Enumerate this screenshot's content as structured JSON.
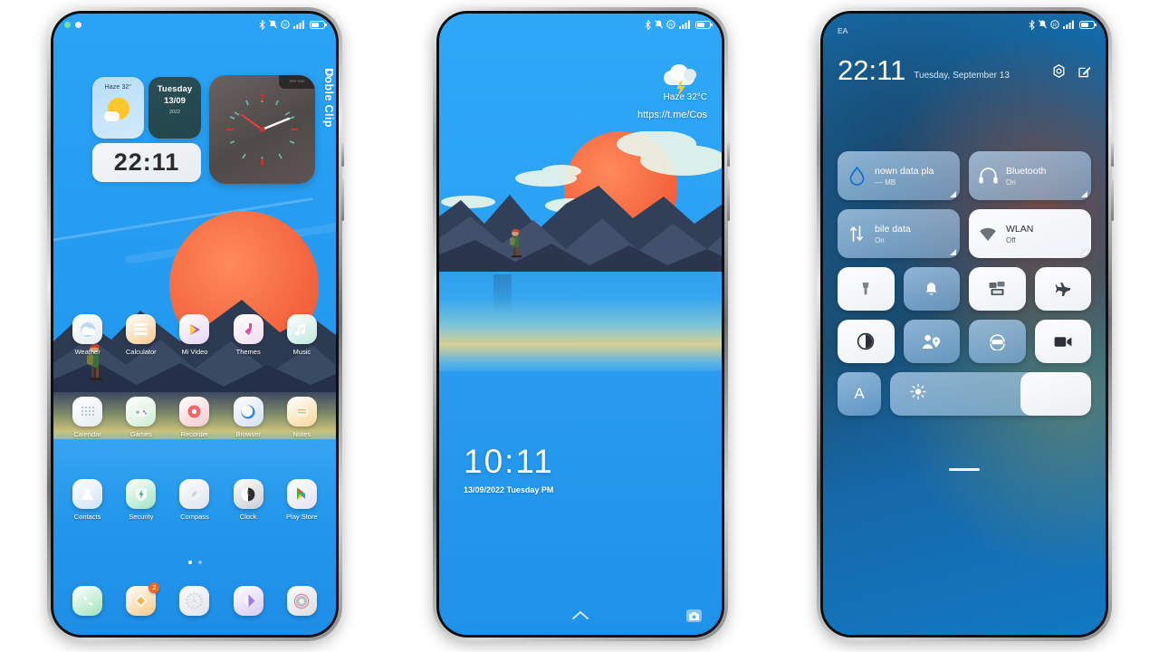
{
  "theme": {
    "accent": "#1f9bf7",
    "sun": "#f4663f",
    "badge": "#f6651f",
    "tile_on": "#a9cdea"
  },
  "phone1": {
    "name": "Home screen",
    "status": {
      "time_dots": [
        "notification-dot-green",
        "notification-dot-white"
      ],
      "icons": [
        "bluetooth",
        "mute",
        "dnd",
        "signal",
        "battery"
      ]
    },
    "widgets": {
      "weather": {
        "label": "Haze 32°",
        "icon": "sun-icon"
      },
      "date": {
        "weekday": "Tuesday",
        "date": "13/09",
        "year": "2022"
      },
      "clock_digital": "22:11",
      "analog_chip": "RRR TIME",
      "side_label": "Doble Clip"
    },
    "apps_row1": [
      {
        "label": "Weather",
        "icon": "weather-icon"
      },
      {
        "label": "Calculator",
        "icon": "calculator-icon"
      },
      {
        "label": "Mi Video",
        "icon": "video-icon"
      },
      {
        "label": "Themes",
        "icon": "themes-icon"
      },
      {
        "label": "Music",
        "icon": "music-icon"
      }
    ],
    "apps_row2": [
      {
        "label": "Calendar",
        "icon": "calendar-icon"
      },
      {
        "label": "Games",
        "icon": "gamepad-icon"
      },
      {
        "label": "Recorder",
        "icon": "recorder-icon"
      },
      {
        "label": "Browser",
        "icon": "browser-icon"
      },
      {
        "label": "Notes",
        "icon": "notes-icon"
      }
    ],
    "apps_row3": [
      {
        "label": "Contacts",
        "icon": "contacts-icon"
      },
      {
        "label": "Security",
        "icon": "shield-icon"
      },
      {
        "label": "Compass",
        "icon": "compass-icon"
      },
      {
        "label": "Clock",
        "icon": "clock-icon"
      },
      {
        "label": "Play Store",
        "icon": "play-store-icon"
      }
    ],
    "dock": [
      {
        "label": "Phone",
        "icon": "phone-icon",
        "badge": ""
      },
      {
        "label": "Messages",
        "icon": "messages-icon",
        "badge": "2"
      },
      {
        "label": "Settings",
        "icon": "gear-icon",
        "badge": ""
      },
      {
        "label": "Gallery",
        "icon": "gallery-icon",
        "badge": ""
      },
      {
        "label": "Camera",
        "icon": "camera-icon",
        "badge": ""
      }
    ],
    "page_dots": {
      "count": 2,
      "active": 0
    }
  },
  "phone2": {
    "name": "Lock screen",
    "weather": {
      "condition_temp": "Haze 32°C",
      "icon": "thunderstorm-cloud-icon"
    },
    "url": "https://t.me/Cos",
    "clock": "10:11",
    "date": "13/09/2022 Tuesday PM",
    "bottom": {
      "unlock_icon": "chevron-up-icon",
      "camera_icon": "camera-icon"
    }
  },
  "phone3": {
    "name": "Control center",
    "carrier": "EA",
    "clock": "22:11",
    "date": "Tuesday, September 13",
    "header_icons": [
      "settings-gear-icon",
      "edit-icon"
    ],
    "big_tiles": [
      {
        "title": "nown data pla",
        "sub": "–– MB",
        "icon": "data-drop-icon",
        "state": "on"
      },
      {
        "title": "Bluetooth",
        "sub": "On",
        "icon": "headphones-icon",
        "state": "on"
      },
      {
        "title": "bile data",
        "sub": "On",
        "icon": "data-arrows-icon",
        "state": "on"
      },
      {
        "title": "WLAN",
        "sub": "Off",
        "icon": "wifi-icon",
        "state": "off"
      }
    ],
    "toggles_row1": [
      {
        "name": "flashlight",
        "icon": "flashlight-icon",
        "state": "off"
      },
      {
        "name": "do-not-disturb",
        "icon": "dnd-bell-icon",
        "state": "on"
      },
      {
        "name": "screen-cast",
        "icon": "cast-icon",
        "state": "off"
      },
      {
        "name": "airplane-mode",
        "icon": "airplane-icon",
        "state": "off"
      }
    ],
    "toggles_row2": [
      {
        "name": "dark-mode",
        "icon": "contrast-icon",
        "state": "off"
      },
      {
        "name": "location",
        "icon": "location-person-icon",
        "state": "on"
      },
      {
        "name": "auto-rotate",
        "icon": "rotate-icon",
        "state": "on"
      },
      {
        "name": "screen-record",
        "icon": "video-record-icon",
        "state": "off"
      }
    ],
    "auto_brightness": {
      "label": "A",
      "state": "on"
    },
    "brightness": {
      "icon": "brightness-sun-icon",
      "value": 65
    }
  }
}
